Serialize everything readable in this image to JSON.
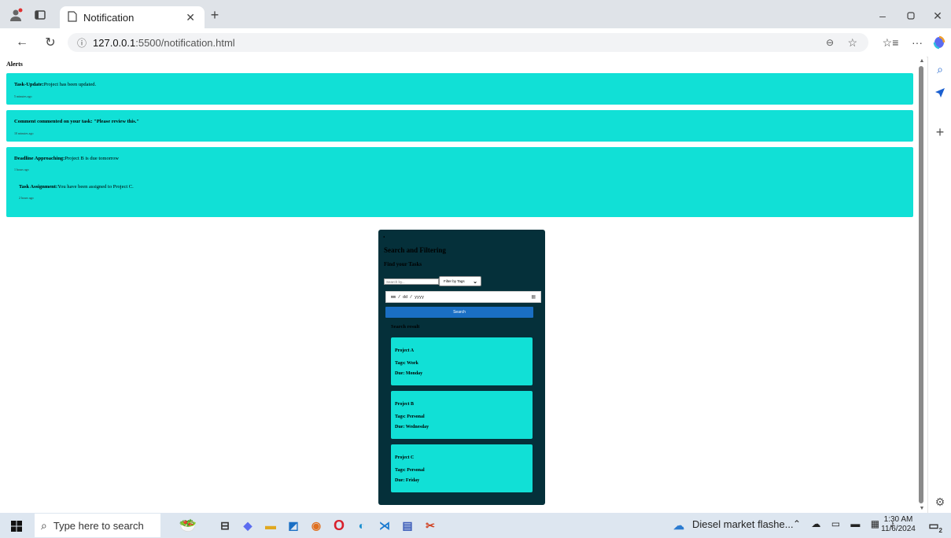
{
  "browser": {
    "tab_title": "Notification",
    "url_host": "127.0.0.1",
    "url_rest": ":5500/notification.html"
  },
  "page": {
    "alerts_title": "Alerts",
    "alerts": [
      {
        "type": "Task-Update:",
        "message": "Project has been updated.",
        "time": "5 minutes ago"
      },
      {
        "type": "Comment commented on your task: \"Please review this.\"",
        "message": "",
        "time": "10 minutes ago"
      },
      {
        "type": "Deadline Approaching:",
        "message": "Project B is due tomorrow",
        "time": "1 hours ago"
      },
      {
        "type": "Task Assignment:",
        "message": "You have been assigned to Project C.",
        "time": "2 hours ago"
      }
    ],
    "search": {
      "dot": ".",
      "title": "Search and Filtering",
      "subtitle": "Find your Tasks",
      "input_placeholder": "Search by...",
      "filter_label": "Filter by Tags",
      "date_placeholder": "mm / dd / yyyy",
      "button_label": "Search",
      "results_title": "Search result",
      "projects": [
        {
          "name": "Project A",
          "tags": "Tags: Work",
          "due": "Due: Monday"
        },
        {
          "name": "Project B",
          "tags": "Tags: Personal",
          "due": "Due: Wednesday"
        },
        {
          "name": "Project C",
          "tags": "Tags: Personal",
          "due": "Due: Friday"
        }
      ]
    }
  },
  "taskbar": {
    "search_placeholder": "Type here to search",
    "news": "Diesel market flashe...",
    "time": "1:30 AM",
    "date": "11/6/2024",
    "notification_count": "2"
  },
  "colors": {
    "alert_bg": "#11e0d6",
    "panel_bg": "#05303a",
    "button_bg": "#1a6fc4"
  }
}
